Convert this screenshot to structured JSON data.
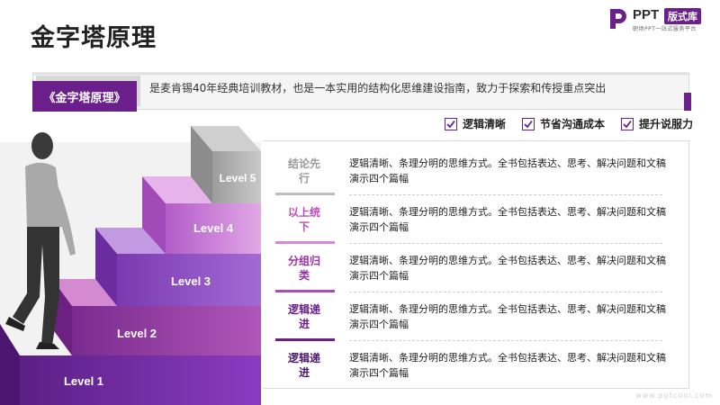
{
  "page": {
    "title": "金字塔原理"
  },
  "logo": {
    "mark_icon": "ppt-logo-icon",
    "brand": "PPT",
    "badge": "版式库",
    "tagline": "职场PPT一站式服务平台"
  },
  "banner": {
    "tag": "《金字塔原理》",
    "text": "是麦肯锡40年经典培训教材，也是一本实用的结构化思维建设指南，致力于探索和传授重点突出"
  },
  "checks": [
    {
      "label": "逻辑清晰",
      "checked": true
    },
    {
      "label": "节省沟通成本",
      "checked": true
    },
    {
      "label": "提升说服力",
      "checked": true
    }
  ],
  "pyramid": {
    "levels": [
      "Level 1",
      "Level 2",
      "Level 3",
      "Level 4",
      "Level 5"
    ]
  },
  "rows": [
    {
      "key": "结论先行",
      "text": "逻辑清晰、条理分明的思维方式。全书包括表达、思考、解决问题和文稿演示四个篇幅"
    },
    {
      "key": "以上统下",
      "text": "逻辑清晰、条理分明的思维方式。全书包括表达、思考、解决问题和文稿演示四个篇幅"
    },
    {
      "key": "分组归类",
      "text": "逻辑清晰、条理分明的思维方式。全书包括表达、思考、解决问题和文稿演示四个篇幅"
    },
    {
      "key": "逻辑递进",
      "text": "逻辑清晰、条理分明的思维方式。全书包括表达、思考、解决问题和文稿演示四个篇幅"
    },
    {
      "key": "逻辑递进",
      "text": "逻辑清晰、条理分明的思维方式。全书包括表达、思考、解决问题和文稿演示四个篇幅"
    }
  ],
  "colors": {
    "accent": "#6a1f8a",
    "key_level5": "#9a9a9a",
    "key_level4": "#c24bb5",
    "key_level3": "#9b2fa8",
    "key_level2": "#6a1f8a",
    "key_level1": "#4b1a6e"
  },
  "watermark": "www.pptcool.com"
}
